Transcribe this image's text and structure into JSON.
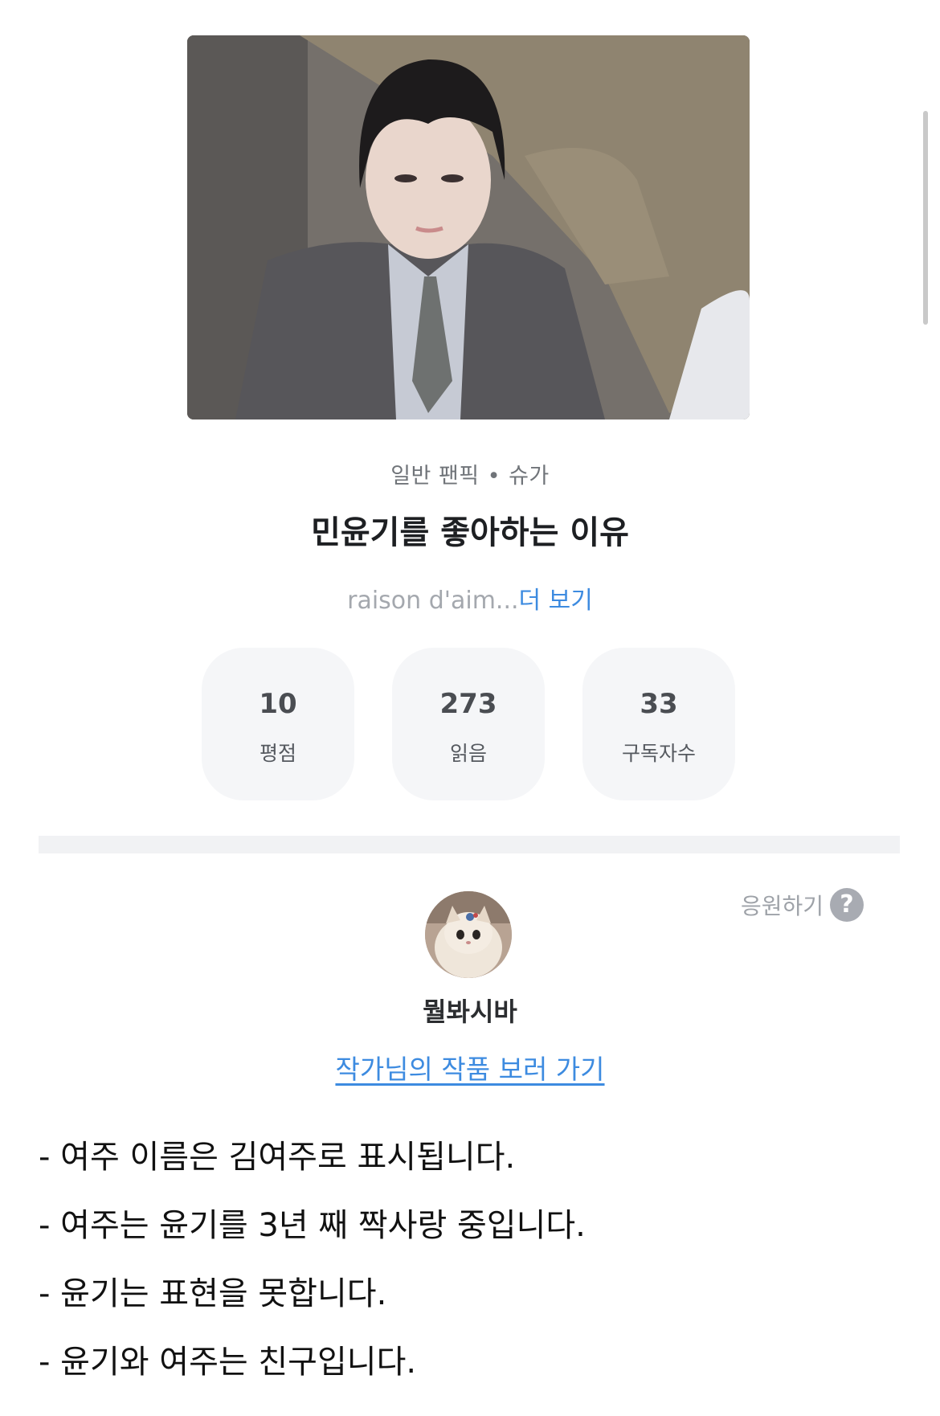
{
  "work": {
    "genre": "일반 팬픽",
    "member": "슈가",
    "title": "민윤기를 좋아하는 이유",
    "description_preview": "raison d'aim...",
    "more_label": "더 보기"
  },
  "stats": [
    {
      "value": "10",
      "label": "평점"
    },
    {
      "value": "273",
      "label": "읽음"
    },
    {
      "value": "33",
      "label": "구독자수"
    }
  ],
  "support": {
    "label": "응원하기",
    "help_icon": "?"
  },
  "author": {
    "name": "뭘봐시바",
    "works_link": "작가님의 작품 보러 가기"
  },
  "notes": [
    "- 여주 이름은 김여주로 표시됩니다.",
    "- 여주는 윤기를 3년 째 짝사랑 중입니다.",
    "- 윤기는 표현을 못합니다.",
    "- 윤기와 여주는 친구입니다."
  ],
  "colors": {
    "link": "#3d8be0",
    "stat_bg": "#f5f6f8",
    "divider": "#f1f2f4"
  }
}
